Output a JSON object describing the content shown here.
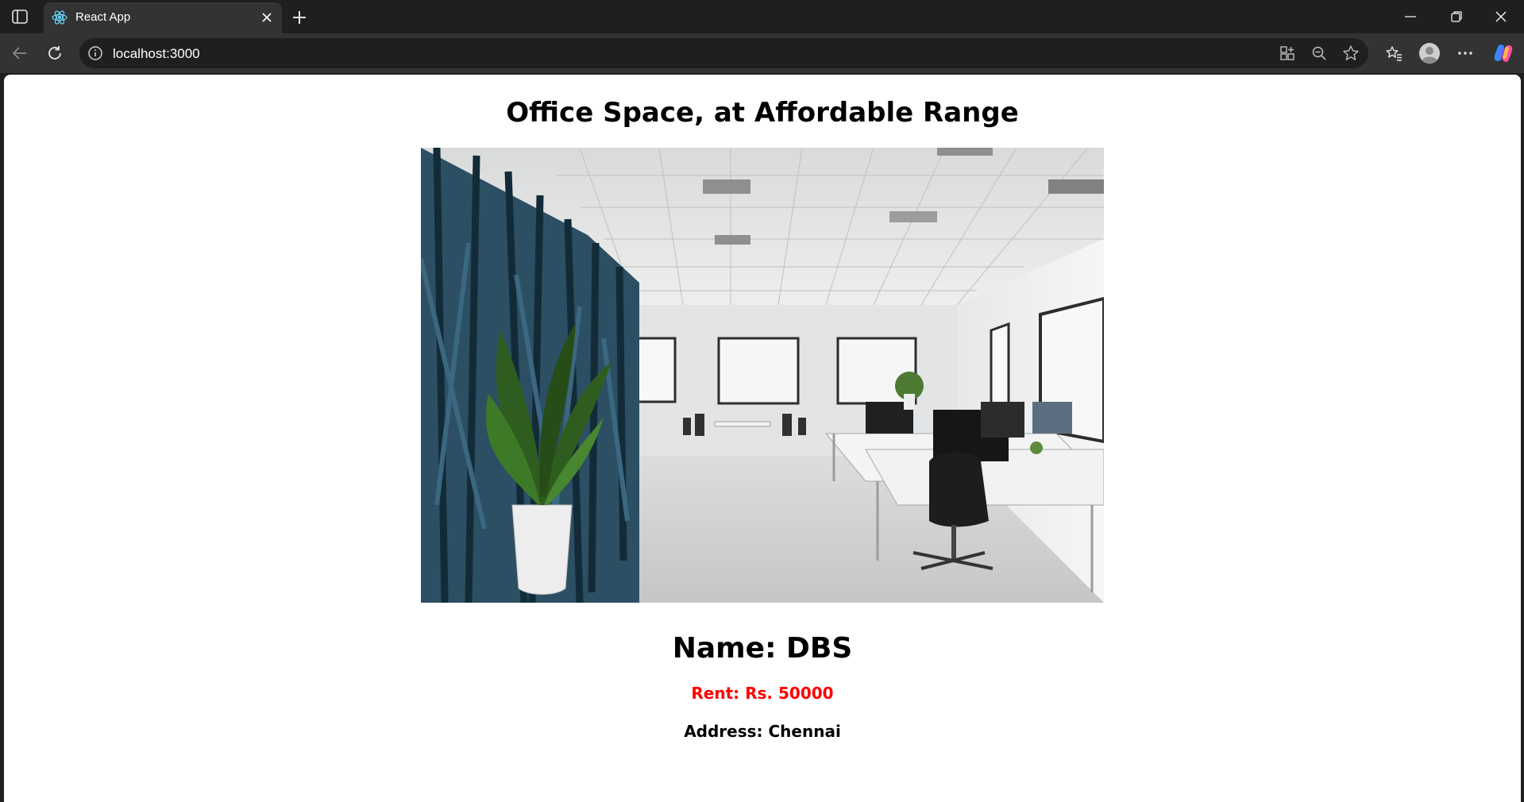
{
  "browser": {
    "tab": {
      "title": "React App",
      "favicon": "react-logo-icon"
    },
    "address_bar": {
      "url": "localhost:3000"
    }
  },
  "page": {
    "title": "Office Space, at Affordable Range",
    "office": {
      "image_alt": "Office Space",
      "name_label": "Name: DBS",
      "rent_label": "Rent: Rs. 50000",
      "address_label": "Address: Chennai",
      "rent_color": "#ff0000"
    }
  },
  "colors": {
    "titlebar": "#1f1f1f",
    "toolbar": "#333333",
    "page_background": "#ffffff"
  }
}
